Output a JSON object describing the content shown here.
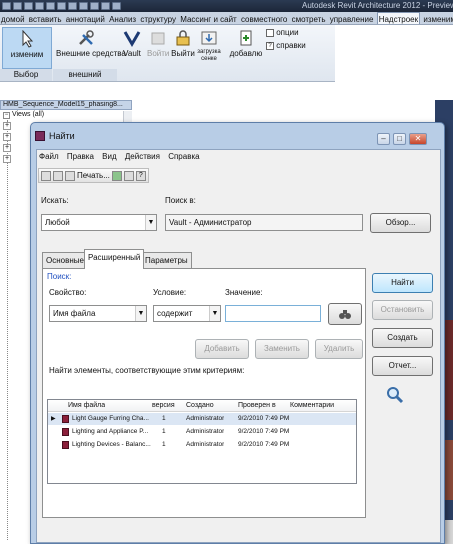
{
  "app": {
    "title": "Autodesk Revit Architecture 2012 - Preview -",
    "tabs": [
      "домой",
      "вставить",
      "аннотаций",
      "Анализ",
      "структуру",
      "Массинг и сайт",
      "совместного",
      "смотреть",
      "управление",
      "Надстроек",
      "изменим"
    ],
    "active_tab": "Надстроек"
  },
  "ribbon": {
    "modify_label": "изменим",
    "external_tools_label": "Внешние средства",
    "vault_label": "Vault",
    "login_label": "Войти",
    "logout_label": "Выйти",
    "load_label": "загрузка сенке",
    "add_label": "добавлю",
    "options_label": "опции",
    "help_label": "справки",
    "panel_select": "Выбор",
    "panel_external": "внешний"
  },
  "project_browser": {
    "title": "HMB_Sequence_Model15_phasing8...",
    "views_node": "Views (all)"
  },
  "dialog": {
    "title": "Найти",
    "menu": [
      "Файл",
      "Правка",
      "Вид",
      "Действия",
      "Справка"
    ],
    "print_label": "Печать...",
    "look_for_label": "Искать:",
    "look_for_value": "Любой",
    "look_in_label": "Поиск в:",
    "look_in_value": "Vault - Администратор",
    "browse_button": "Обзор...",
    "tabs": [
      "Основные",
      "Расширенный",
      "Параметры"
    ],
    "active_tab": "Расширенный",
    "search_link": "Поиск:",
    "property_label": "Свойство:",
    "property_value": "Имя файла",
    "condition_label": "Условие:",
    "condition_value": "содержит",
    "value_label": "Значение:",
    "value_value": "",
    "add_button": "Добавить",
    "replace_button": "Заменить",
    "remove_button": "Удалить",
    "results_caption": "Найти элементы, соответствующие этим критериям:",
    "columns": [
      "Имя файла",
      "версия",
      "Создано",
      "Проверен в",
      "Комментарии"
    ],
    "rows": [
      {
        "name": "Light Gauge Furring Cha...",
        "version": "1",
        "created": "Administrator",
        "checked_in": "9/2/2010 7:49 PM",
        "comment": ""
      },
      {
        "name": "Lighting and Appliance P...",
        "version": "1",
        "created": "Administrator",
        "checked_in": "9/2/2010 7:49 PM",
        "comment": ""
      },
      {
        "name": "Lighting Devices - Balanc...",
        "version": "1",
        "created": "Administrator",
        "checked_in": "9/2/2010 7:49 PM",
        "comment": ""
      }
    ],
    "find_button": "Найти",
    "stop_button": "Остановить",
    "new_button": "Создать",
    "report_button": "Отчет..."
  }
}
